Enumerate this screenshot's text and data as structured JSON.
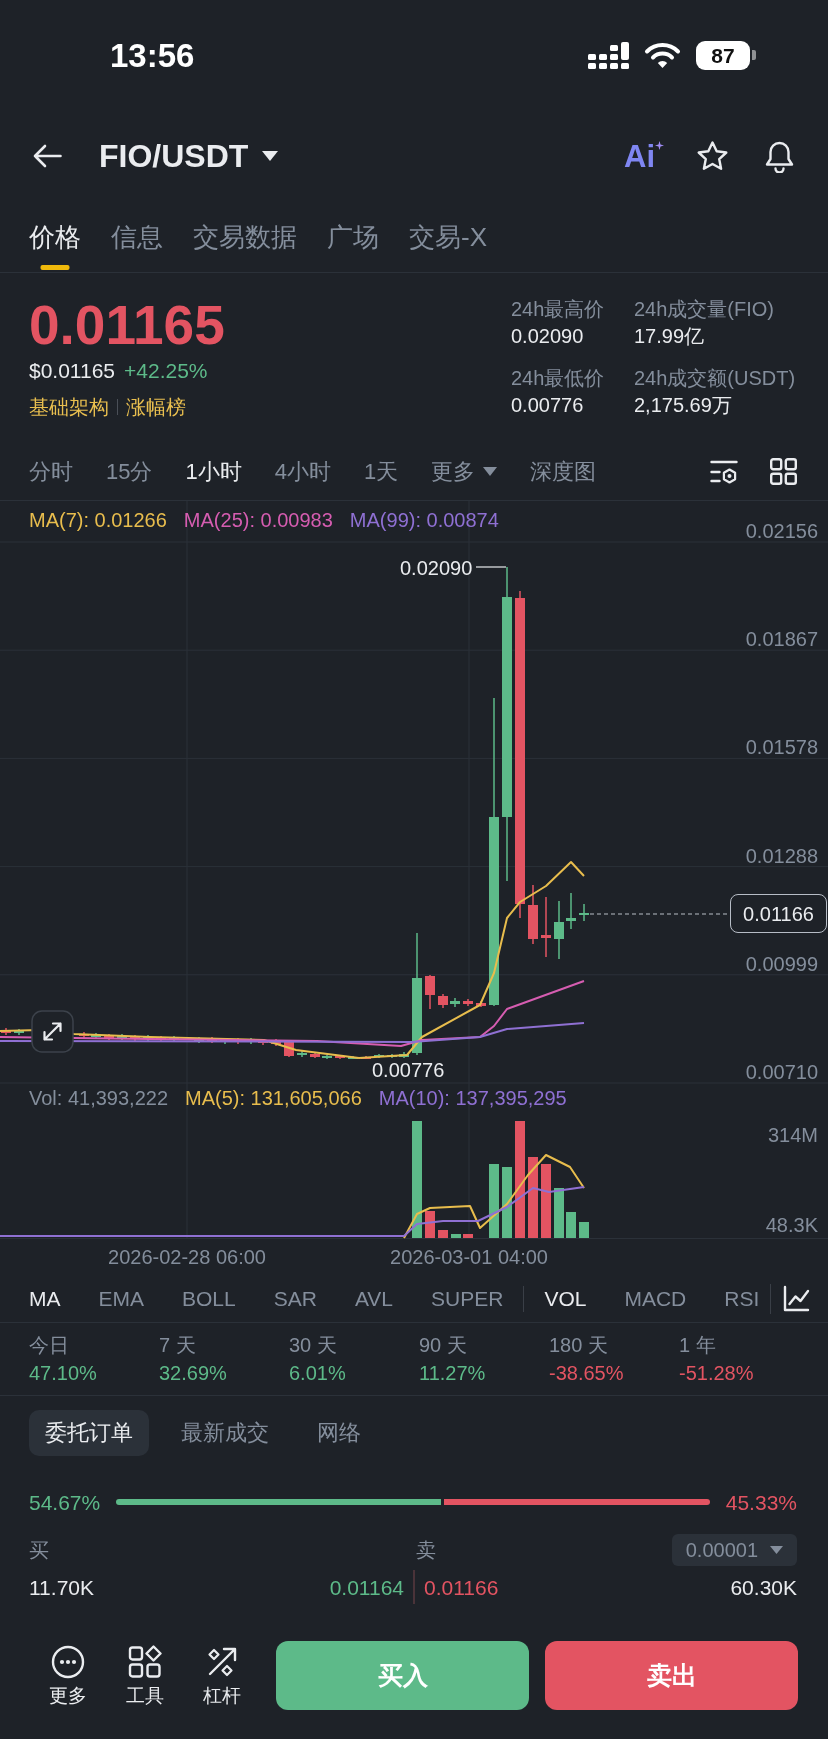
{
  "status_bar": {
    "time": "13:56",
    "battery": "87"
  },
  "header": {
    "pair": "FIO/USDT",
    "ai_label": "Ai"
  },
  "tabs": [
    {
      "label": "价格",
      "selected": true
    },
    {
      "label": "信息",
      "selected": false
    },
    {
      "label": "交易数据",
      "selected": false
    },
    {
      "label": "广场",
      "selected": false
    },
    {
      "label": "交易-X",
      "selected": false
    }
  ],
  "ticker": {
    "last_price": "0.01165",
    "usd_price": "$0.01165",
    "change": "+42.25%",
    "tags": [
      "基础架构",
      "涨幅榜"
    ],
    "stats": [
      {
        "label": "24h最高价",
        "value": "0.02090"
      },
      {
        "label": "24h成交量(FIO)",
        "value": "17.99亿"
      },
      {
        "label": "24h最低价",
        "value": "0.00776"
      },
      {
        "label": "24h成交额(USDT)",
        "value": "2,175.69万"
      }
    ]
  },
  "intervals": [
    {
      "label": "分时",
      "selected": false,
      "kind": "option"
    },
    {
      "label": "15分",
      "selected": false,
      "kind": "option"
    },
    {
      "label": "1小时",
      "selected": true,
      "kind": "option"
    },
    {
      "label": "4小时",
      "selected": false,
      "kind": "option"
    },
    {
      "label": "1天",
      "selected": false,
      "kind": "option"
    },
    {
      "label": "更多",
      "selected": false,
      "kind": "dropdown"
    },
    {
      "label": "深度图",
      "selected": false,
      "kind": "option"
    }
  ],
  "price_chart": {
    "legend": [
      {
        "text": "MA(7): 0.01266",
        "color": "#e8bd4d"
      },
      {
        "text": "MA(25): 0.00983",
        "color": "#d65db1"
      },
      {
        "text": "MA(99): 0.00874",
        "color": "#8f70d3"
      }
    ],
    "y_labels": [
      "0.02156",
      "0.01867",
      "0.01578",
      "0.01288",
      "0.00999",
      "0.00710"
    ],
    "high_label": "0.02090",
    "low_label": "0.00776",
    "last_price_label": "0.01166"
  },
  "volume_chart": {
    "legend": [
      {
        "text": "Vol: 41,393,222",
        "color": "#848e9c"
      },
      {
        "text": "MA(5): 131,605,066",
        "color": "#e8bd4d"
      },
      {
        "text": "MA(10): 137,395,295",
        "color": "#8f70d3"
      }
    ],
    "y_labels": [
      "314M",
      "48.3K"
    ],
    "x_labels": [
      "2026-02-28 06:00",
      "2026-03-01 04:00"
    ]
  },
  "indicators": {
    "main": [
      {
        "label": "MA",
        "selected": true
      },
      {
        "label": "EMA",
        "selected": false
      },
      {
        "label": "BOLL",
        "selected": false
      },
      {
        "label": "SAR",
        "selected": false
      },
      {
        "label": "AVL",
        "selected": false
      },
      {
        "label": "SUPER",
        "selected": false
      }
    ],
    "sub": [
      {
        "label": "VOL",
        "selected": true
      },
      {
        "label": "MACD",
        "selected": false
      },
      {
        "label": "RSI",
        "selected": false
      }
    ]
  },
  "performance": [
    {
      "period": "今日",
      "change": "47.10%",
      "color": "#5dba89"
    },
    {
      "period": "7 天",
      "change": "32.69%",
      "color": "#5dba89"
    },
    {
      "period": "30 天",
      "change": "6.01%",
      "color": "#5dba89"
    },
    {
      "period": "90 天",
      "change": "11.27%",
      "color": "#5dba89"
    },
    {
      "period": "180 天",
      "change": "-38.65%",
      "color": "#e35462"
    },
    {
      "period": "1 年",
      "change": "-51.28%",
      "color": "#e35462"
    }
  ],
  "order_tabs": [
    {
      "label": "委托订单",
      "selected": true
    },
    {
      "label": "最新成交",
      "selected": false
    },
    {
      "label": "网络",
      "selected": false
    }
  ],
  "order_book": {
    "buy_share": "54.67%",
    "sell_share": "45.33%",
    "level": 0.5467,
    "buy_header": "买",
    "sell_header": "卖",
    "tick_size": "0.00001",
    "rows": [
      {
        "bid_size": "11.70K",
        "bid_price": "0.01164",
        "ask_price": "0.01166",
        "ask_size": "60.30K"
      }
    ]
  },
  "bottom_bar": {
    "actions": [
      {
        "label": "更多"
      },
      {
        "label": "工具"
      },
      {
        "label": "杠杆"
      }
    ],
    "buy_button": "买入",
    "sell_button": "卖出"
  }
}
